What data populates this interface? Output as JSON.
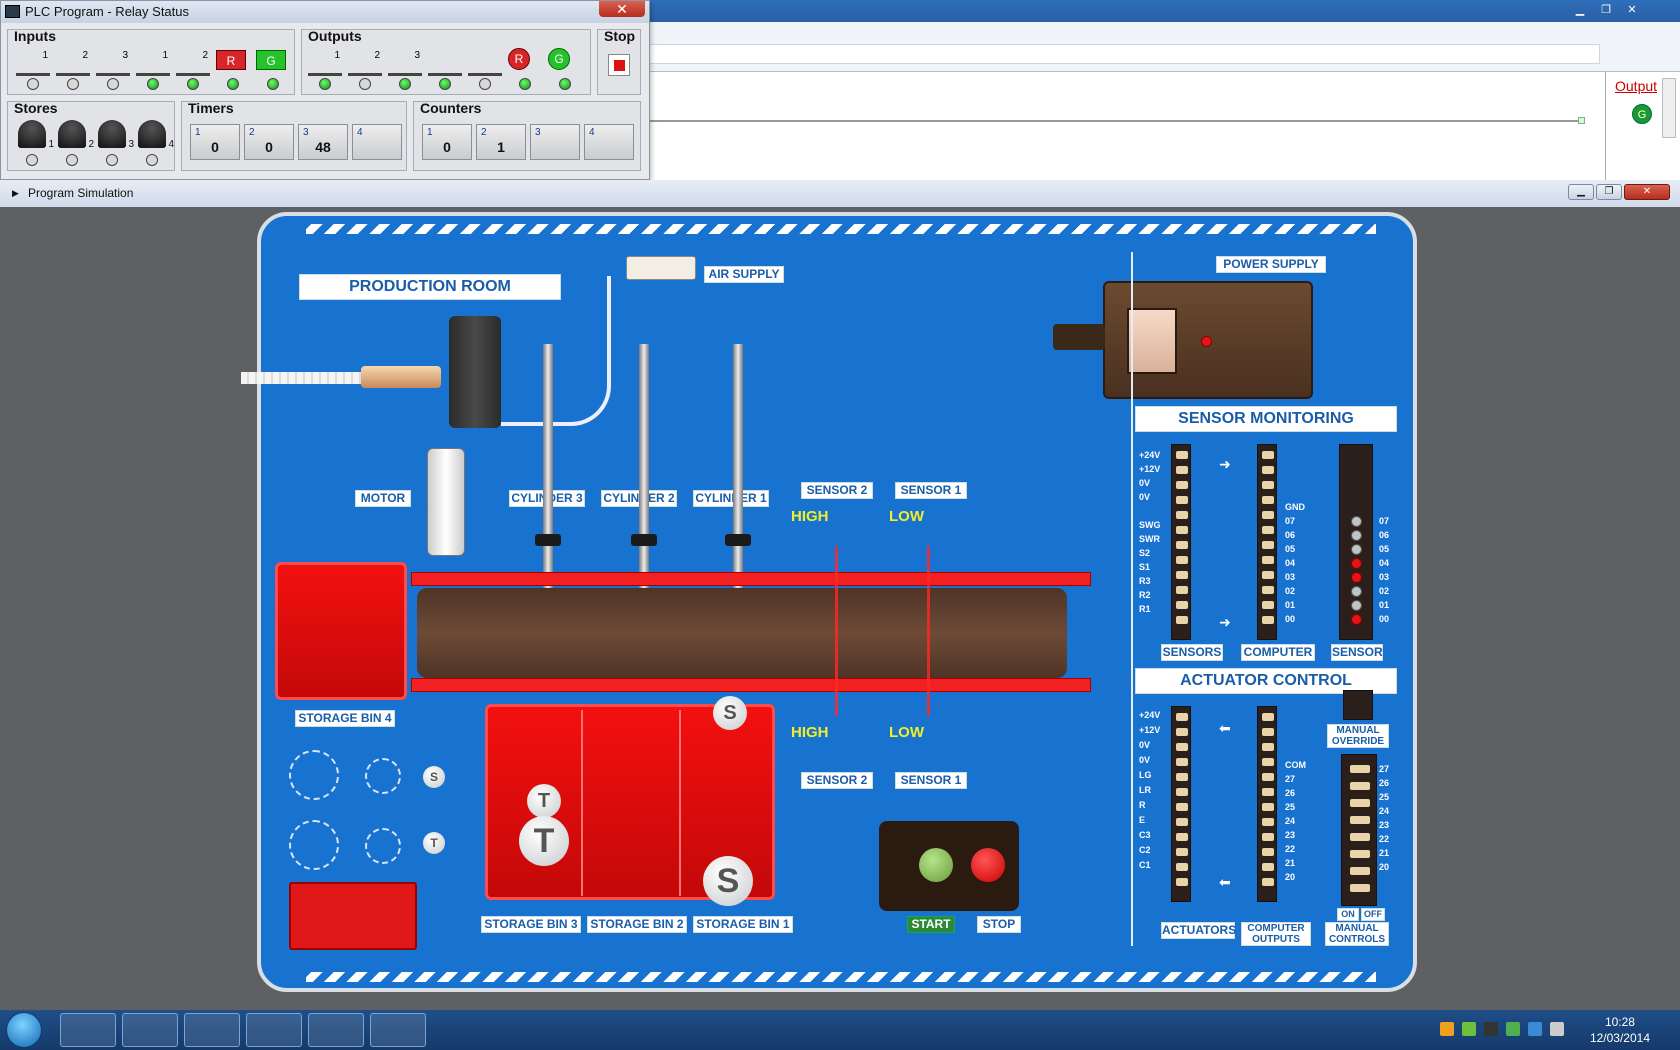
{
  "main_window": {
    "output_label": "Output",
    "output_icon": "G"
  },
  "relay_window": {
    "title": "PLC Program - Relay Status",
    "close": "✕",
    "inputs": {
      "title": "Inputs",
      "labels": [
        "1",
        "2",
        "3",
        "1",
        "2",
        "R",
        "G"
      ],
      "leds_on": [
        false,
        false,
        false,
        true,
        true,
        true,
        true
      ]
    },
    "outputs": {
      "title": "Outputs",
      "labels": [
        "1",
        "2",
        "3",
        "",
        "",
        "R",
        "G"
      ],
      "leds_on": [
        true,
        false,
        true,
        true,
        false,
        true,
        true
      ]
    },
    "stop": {
      "title": "Stop"
    },
    "stores": {
      "title": "Stores",
      "items": [
        "1",
        "2",
        "3",
        "4"
      ]
    },
    "timers": {
      "title": "Timers",
      "items": [
        {
          "num": "1",
          "value": "0"
        },
        {
          "num": "2",
          "value": "0"
        },
        {
          "num": "3",
          "value": "48"
        },
        {
          "num": "4",
          "value": ""
        }
      ]
    },
    "counters": {
      "title": "Counters",
      "items": [
        {
          "num": "1",
          "value": "0"
        },
        {
          "num": "2",
          "value": "1"
        },
        {
          "num": "3",
          "value": ""
        },
        {
          "num": "4",
          "value": ""
        }
      ]
    }
  },
  "sim_window": {
    "title": "Program Simulation",
    "labels": {
      "production_room": "PRODUCTION ROOM",
      "air_supply": "AIR SUPPLY",
      "power_supply": "POWER SUPPLY",
      "motor": "MOTOR",
      "cylinder3": "CYLINDER 3",
      "cylinder2": "CYLINDER 2",
      "cylinder1": "CYLINDER 1",
      "sensor2_top": "SENSOR 2",
      "sensor1_top": "SENSOR 1",
      "sensor2_bottom": "SENSOR 2",
      "sensor1_bottom": "SENSOR 1",
      "high_top": "HIGH",
      "low_top": "LOW",
      "high_bottom": "HIGH",
      "low_bottom": "LOW",
      "storage_bin4": "STORAGE BIN 4",
      "storage_bin3": "STORAGE BIN 3",
      "storage_bin2": "STORAGE BIN 2",
      "storage_bin1": "STORAGE BIN 1",
      "start": "START",
      "stop": "STOP",
      "sensor_monitoring": "SENSOR MONITORING",
      "actuator_control": "ACTUATOR CONTROL",
      "sensors": "SENSORS",
      "computer": "COMPUTER",
      "sensor": "SENSOR",
      "actuators": "ACTUATORS",
      "computer_outputs": "COMPUTER OUTPUTS",
      "manual_controls": "MANUAL CONTROLS",
      "manual_override": "MANUAL OVERRIDE",
      "on": "ON",
      "off": "OFF",
      "gnd": "GND",
      "com": "COM",
      "disc_s": "S",
      "disc_t": "T"
    },
    "sensor_left_labels": [
      "+24V",
      "+12V",
      "0V",
      "0V",
      "",
      "SWG",
      "SWR",
      "S2",
      "S1",
      "R3",
      "R2",
      "R1"
    ],
    "sensor_right_numbers": [
      "07",
      "06",
      "05",
      "04",
      "03",
      "02",
      "01",
      "00"
    ],
    "sensor_led_state": [
      "off",
      "off",
      "off",
      "on",
      "on",
      "off",
      "off",
      "on"
    ],
    "actuator_left_labels": [
      "+24V",
      "+12V",
      "0V",
      "0V",
      "LG",
      "LR",
      "R",
      "E",
      "C3",
      "C2",
      "C1"
    ],
    "actuator_right_numbers": [
      "27",
      "26",
      "25",
      "24",
      "23",
      "22",
      "21",
      "20"
    ]
  },
  "taskbar": {
    "time": "10:28",
    "date": "12/03/2014"
  }
}
